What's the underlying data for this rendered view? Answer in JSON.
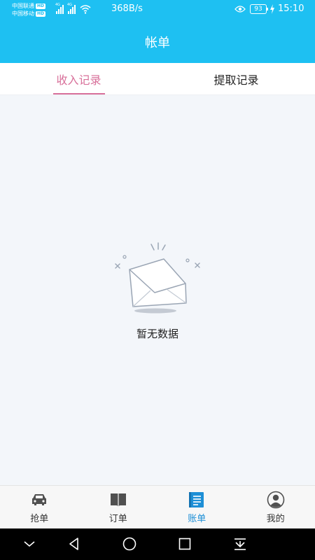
{
  "status_bar": {
    "carrier_1": "中国联通",
    "carrier_2": "中国移动",
    "hd_label": "HD",
    "net_type": "4G",
    "net_speed": "368B/s",
    "battery": "93",
    "time": "15:10"
  },
  "header": {
    "title": "帐单"
  },
  "tabs": [
    {
      "label": "收入记录"
    },
    {
      "label": "提取记录"
    }
  ],
  "empty_state": {
    "text": "暂无数据"
  },
  "bottom_nav": [
    {
      "label": "抢单",
      "icon": "car-icon"
    },
    {
      "label": "订单",
      "icon": "book-icon"
    },
    {
      "label": "账单",
      "icon": "bill-icon"
    },
    {
      "label": "我的",
      "icon": "user-icon"
    }
  ],
  "colors": {
    "primary": "#1ec0f2",
    "tab_active": "#d8709a",
    "nav_active": "#1e8fd6"
  }
}
